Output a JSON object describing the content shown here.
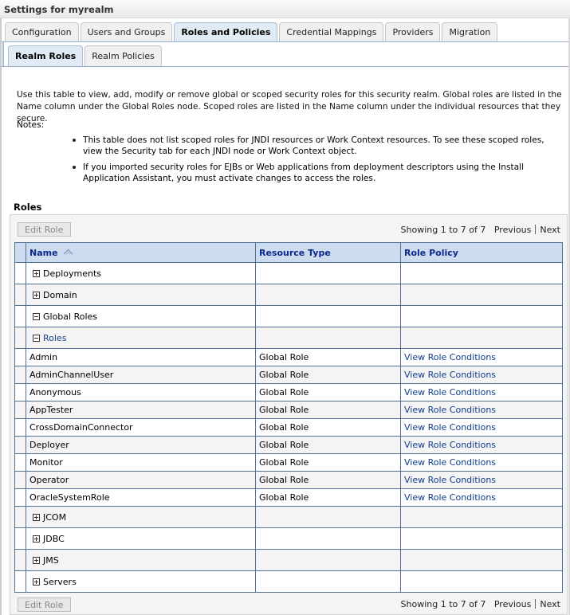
{
  "page": {
    "title": "Settings for myrealm"
  },
  "tabs": [
    {
      "label": "Configuration",
      "active": false
    },
    {
      "label": "Users and Groups",
      "active": false
    },
    {
      "label": "Roles and Policies",
      "active": true
    },
    {
      "label": "Credential Mappings",
      "active": false
    },
    {
      "label": "Providers",
      "active": false
    },
    {
      "label": "Migration",
      "active": false
    }
  ],
  "subtabs": [
    {
      "label": "Realm Roles",
      "active": true
    },
    {
      "label": "Realm Policies",
      "active": false
    }
  ],
  "intro": "Use this table to view, add, modify or remove global or scoped security roles for this security realm. Global roles are listed in the Name column under the Global Roles node. Scoped roles are listed in the Name column under the individual resources that they secure.",
  "notes": {
    "label": "Notes:",
    "items": [
      "This table does not list scoped roles for JNDI resources or Work Context resources. To see these scoped roles, view the Security tab for each JNDI node or Work Context object.",
      "If you imported security roles for EJBs or Web applications from deployment descriptors using the Install Application Assistant, you must activate changes to access the roles."
    ]
  },
  "roles_section": {
    "title": "Roles",
    "edit_button": "Edit Role",
    "pager": {
      "count": "Showing 1 to 7 of 7",
      "previous": "Previous",
      "next": "Next"
    },
    "columns": {
      "name": "Name",
      "resource_type": "Resource Type",
      "role_policy": "Role Policy"
    },
    "sort_icon": "sort-ascending-icon",
    "tree": [
      {
        "label": "Deployments",
        "expander": "plus"
      },
      {
        "label": "Domain",
        "expander": "plus"
      },
      {
        "label": "Global Roles",
        "expander": "minus"
      },
      {
        "label": "Roles",
        "expander": "minus"
      }
    ],
    "rows": [
      {
        "name": "Admin",
        "resource_type": "Global Role",
        "policy": "View Role Conditions"
      },
      {
        "name": "AdminChannelUser",
        "resource_type": "Global Role",
        "policy": "View Role Conditions"
      },
      {
        "name": "Anonymous",
        "resource_type": "Global Role",
        "policy": "View Role Conditions"
      },
      {
        "name": "AppTester",
        "resource_type": "Global Role",
        "policy": "View Role Conditions"
      },
      {
        "name": "CrossDomainConnector",
        "resource_type": "Global Role",
        "policy": "View Role Conditions"
      },
      {
        "name": "Deployer",
        "resource_type": "Global Role",
        "policy": "View Role Conditions"
      },
      {
        "name": "Monitor",
        "resource_type": "Global Role",
        "policy": "View Role Conditions"
      },
      {
        "name": "Operator",
        "resource_type": "Global Role",
        "policy": "View Role Conditions"
      },
      {
        "name": "OracleSystemRole",
        "resource_type": "Global Role",
        "policy": "View Role Conditions"
      }
    ],
    "tree_after": [
      {
        "label": "JCOM",
        "expander": "plus"
      },
      {
        "label": "JDBC",
        "expander": "plus"
      },
      {
        "label": "JMS",
        "expander": "plus"
      },
      {
        "label": "Servers",
        "expander": "plus"
      }
    ]
  }
}
